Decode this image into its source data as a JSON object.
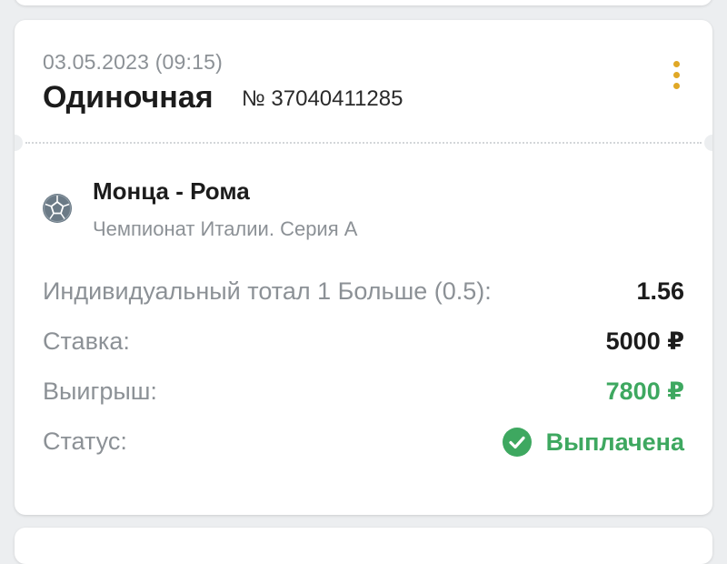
{
  "bet": {
    "date": "03.05.2023 (09:15)",
    "type": "Одиночная",
    "number": "№ 37040411285"
  },
  "match": {
    "title": "Монца - Рома",
    "league": "Чемпионат Италии. Серия А",
    "icon": "football-ball-icon"
  },
  "details": {
    "market_label": "Индивидуальный тотал 1 Больше (0.5):",
    "odds": "1.56",
    "stake_label": "Ставка:",
    "stake": "5000 ₽",
    "win_label": "Выигрыш:",
    "win": "7800 ₽",
    "status_label": "Статус:",
    "status": "Выплачена"
  },
  "colors": {
    "accent_menu": "#e0a826",
    "success": "#3ea860",
    "muted_text": "#8c9196",
    "primary_text": "#1c1c1c"
  },
  "icons": {
    "menu": "more-vertical-icon",
    "status": "check-circle-icon"
  }
}
